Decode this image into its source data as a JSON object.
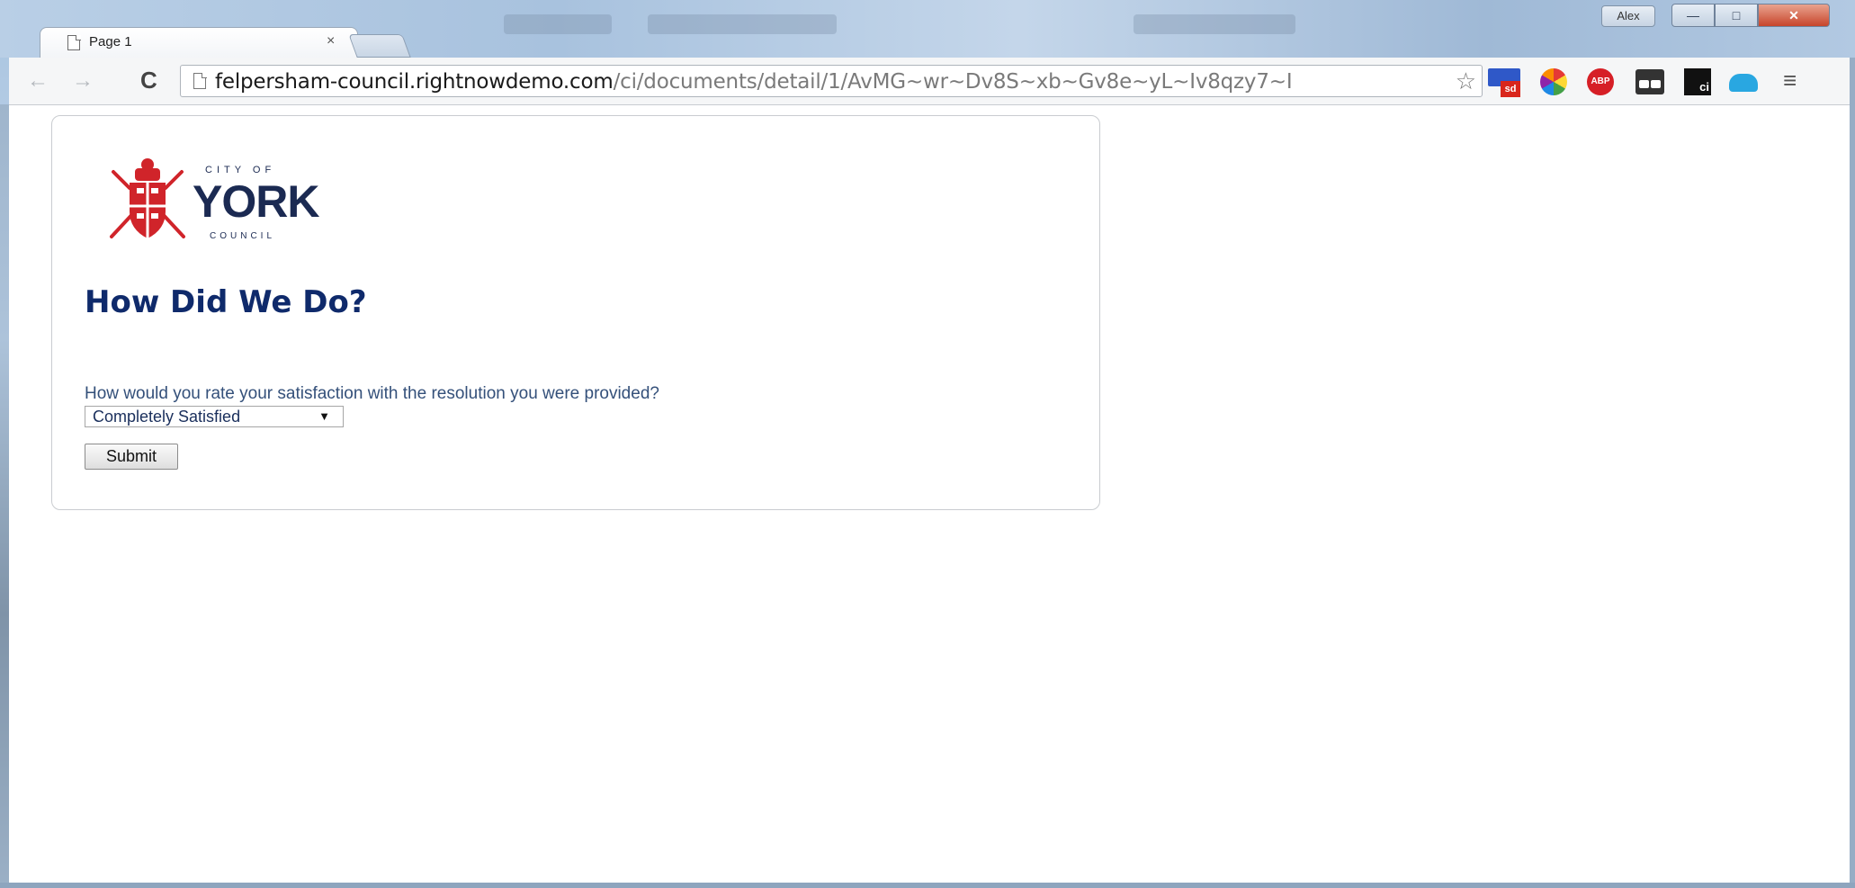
{
  "window": {
    "profile_name": "Alex",
    "controls": {
      "minimize": "—",
      "maximize": "□",
      "close": "✕"
    }
  },
  "tab": {
    "title": "Page 1",
    "close": "×",
    "icon": "page-icon"
  },
  "toolbar": {
    "back": "←",
    "forward": "→",
    "reload": "C",
    "url_host": "felpersham-council.rightnowdemo.com",
    "url_path": "/ci/documents/detail/1/AvMG~wr~Dv8S~xb~Gv8e~yL~Iv8qzy7~I",
    "star": "☆",
    "menu": "≡",
    "extensions": {
      "sd_badge": "sd",
      "abp_label": "ABP",
      "ci_label": "ci"
    }
  },
  "page": {
    "logo": {
      "top": "CITY OF",
      "main": "YORK",
      "bottom": "COUNCIL"
    },
    "heading": "How Did We Do?",
    "question": "How would you rate your satisfaction with the resolution you were provided?",
    "rating_select": {
      "selected": "Completely Satisfied",
      "arrow": "▼"
    },
    "submit_label": "Submit"
  },
  "colors": {
    "heading": "#0f2a6b",
    "question": "#34507a",
    "logo_red": "#d0242a",
    "logo_navy": "#1b2a52"
  }
}
